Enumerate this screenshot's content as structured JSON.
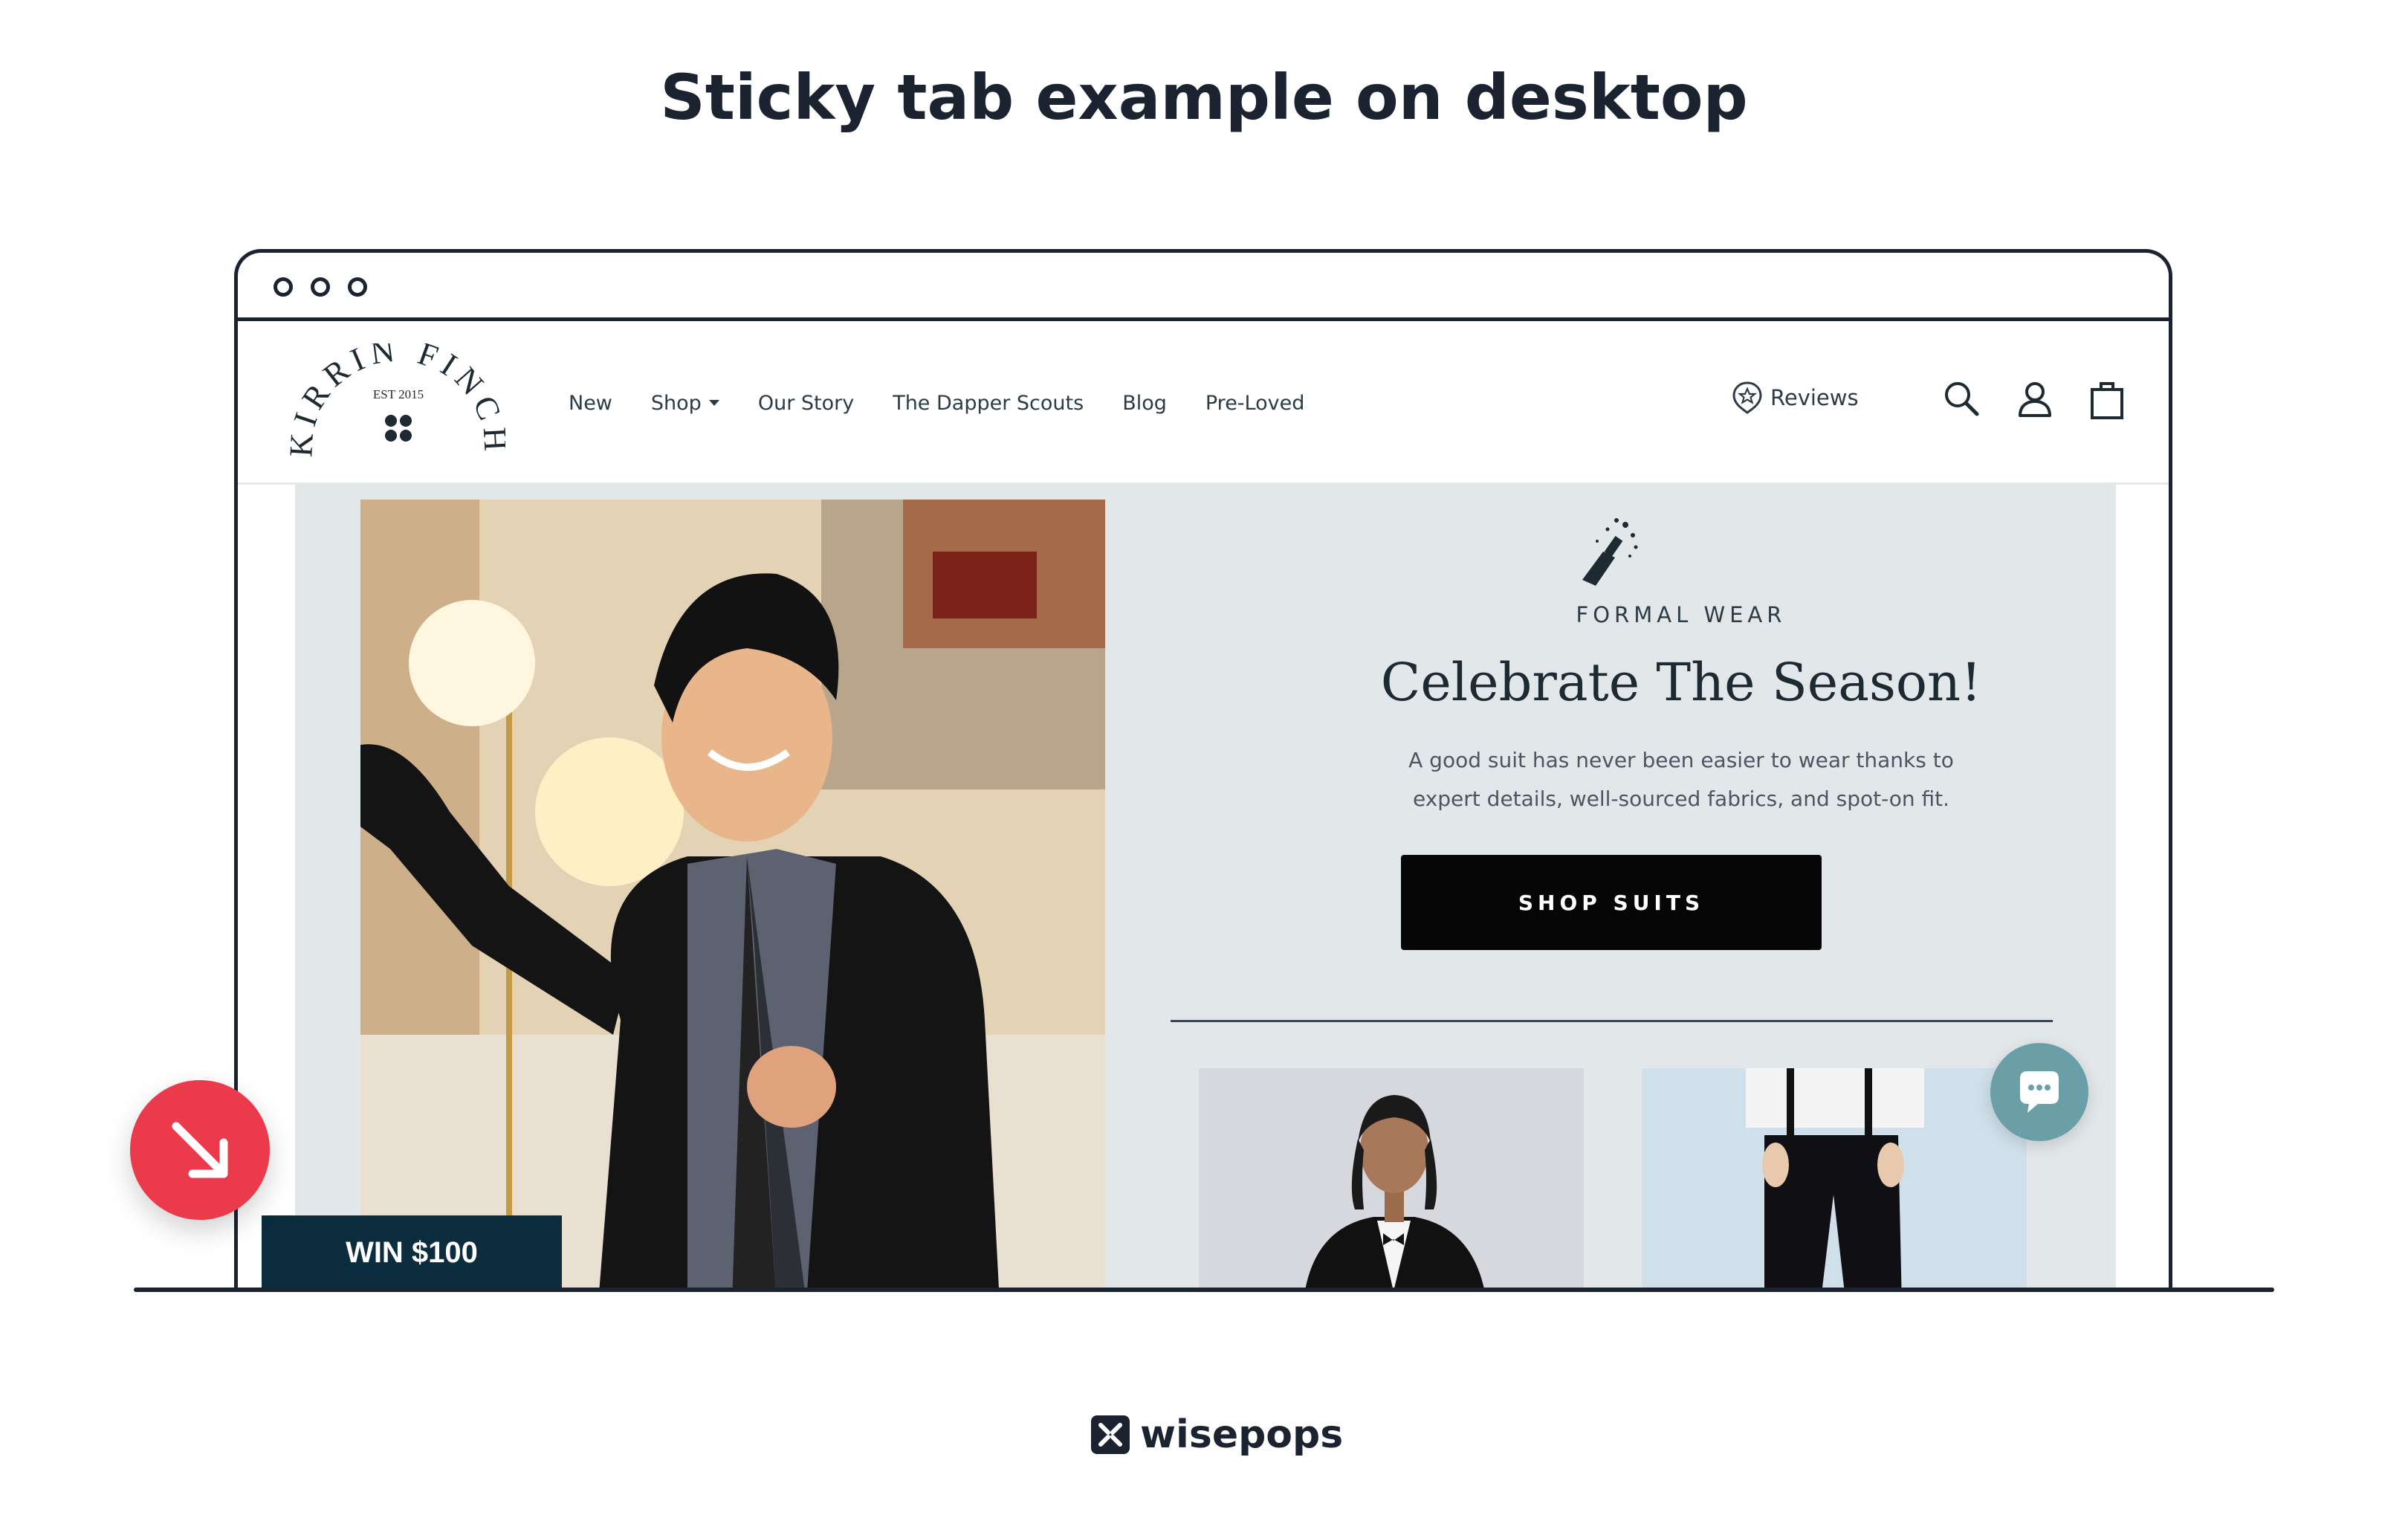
{
  "headline": "Sticky tab example on desktop",
  "site": {
    "logo": {
      "name_arc": "KIRRIN FINCH",
      "established": "EST 2015"
    },
    "nav": [
      "New",
      "Shop",
      "Our Story",
      "The Dapper Scouts",
      "Blog",
      "Pre-Loved"
    ],
    "reviews_label": "Reviews",
    "icons": [
      "search-icon",
      "account-icon",
      "cart-icon"
    ]
  },
  "hero": {
    "eyebrow": "FORMAL WEAR",
    "title": "Celebrate The Season!",
    "body_line1": "A good suit has never been easier to wear thanks to",
    "body_line2": "expert details, well-sourced fabrics, and spot-on fit.",
    "cta_label": "SHOP SUITS"
  },
  "sticky_tab": {
    "label": "WIN $100"
  },
  "footer_brand": "wisepops",
  "colors": {
    "sticky_tab_bg": "#0c2d3e",
    "arrow_badge": "#ec3a4d",
    "chat_bubble": "#6a9fa8",
    "cta_bg": "#060606",
    "hero_bg": "#e2e7ea"
  }
}
